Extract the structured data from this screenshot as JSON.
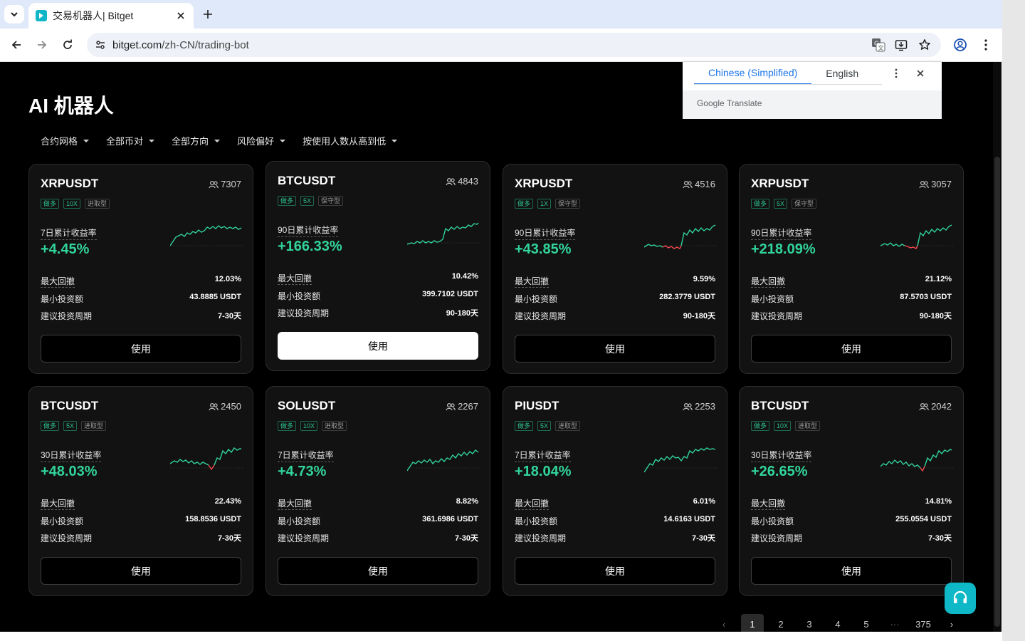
{
  "browser": {
    "tab_title": "交易机器人| Bitget",
    "url_host": "bitget.com",
    "url_path": "/zh-CN/trading-bot",
    "favicon_color": "#11b5c8"
  },
  "translate": {
    "source_lang": "Chinese (Simplified)",
    "target_lang": "English",
    "brand": "Google Translate"
  },
  "page": {
    "title": "AI 机器人",
    "filters": [
      "合约网格",
      "全部币对",
      "全部方向",
      "风险偏好",
      "按使用人数从高到低"
    ],
    "labels": {
      "max_drawdown": "最大回撤",
      "min_invest": "最小投资额",
      "period": "建议投资周期",
      "use": "使用"
    }
  },
  "cards": [
    {
      "pair": "XRPUSDT",
      "users": "7307",
      "tags": [
        "做多",
        "10X",
        "进取型"
      ],
      "roi_label": "7日累计收益率",
      "roi": "+4.45%",
      "drawdown": "12.03%",
      "min_invest": "43.8885 USDT",
      "period": "7-30天"
    },
    {
      "pair": "BTCUSDT",
      "users": "4843",
      "tags": [
        "做多",
        "5X",
        "保守型"
      ],
      "roi_label": "90日累计收益率",
      "roi": "+166.33%",
      "drawdown": "10.42%",
      "min_invest": "399.7102 USDT",
      "period": "90-180天"
    },
    {
      "pair": "XRPUSDT",
      "users": "4516",
      "tags": [
        "做多",
        "1X",
        "保守型"
      ],
      "roi_label": "90日累计收益率",
      "roi": "+43.85%",
      "drawdown": "9.59%",
      "min_invest": "282.3779 USDT",
      "period": "90-180天"
    },
    {
      "pair": "XRPUSDT",
      "users": "3057",
      "tags": [
        "做多",
        "5X",
        "保守型"
      ],
      "roi_label": "90日累计收益率",
      "roi": "+218.09%",
      "drawdown": "21.12%",
      "min_invest": "87.5703 USDT",
      "period": "90-180天"
    },
    {
      "pair": "BTCUSDT",
      "users": "2450",
      "tags": [
        "做多",
        "5X",
        "进取型"
      ],
      "roi_label": "30日累计收益率",
      "roi": "+48.03%",
      "drawdown": "22.43%",
      "min_invest": "158.8536 USDT",
      "period": "7-30天"
    },
    {
      "pair": "SOLUSDT",
      "users": "2267",
      "tags": [
        "做多",
        "10X",
        "进取型"
      ],
      "roi_label": "7日累计收益率",
      "roi": "+4.73%",
      "drawdown": "8.82%",
      "min_invest": "361.6986 USDT",
      "period": "7-30天"
    },
    {
      "pair": "PIUSDT",
      "users": "2253",
      "tags": [
        "做多",
        "5X",
        "进取型"
      ],
      "roi_label": "7日累计收益率",
      "roi": "+18.04%",
      "drawdown": "6.01%",
      "min_invest": "14.6163 USDT",
      "period": "7-30天"
    },
    {
      "pair": "BTCUSDT",
      "users": "2042",
      "tags": [
        "做多",
        "10X",
        "进取型"
      ],
      "roi_label": "30日累计收益率",
      "roi": "+26.65%",
      "drawdown": "14.81%",
      "min_invest": "255.0554 USDT",
      "period": "7-30天"
    }
  ],
  "pagination": {
    "pages": [
      "1",
      "2",
      "3",
      "4",
      "5"
    ],
    "ellipsis": "···",
    "last": "375",
    "current": "1"
  },
  "colors": {
    "accent_green": "#31d49a",
    "loss_red": "#f5484f",
    "support": "#0fb8c6"
  }
}
